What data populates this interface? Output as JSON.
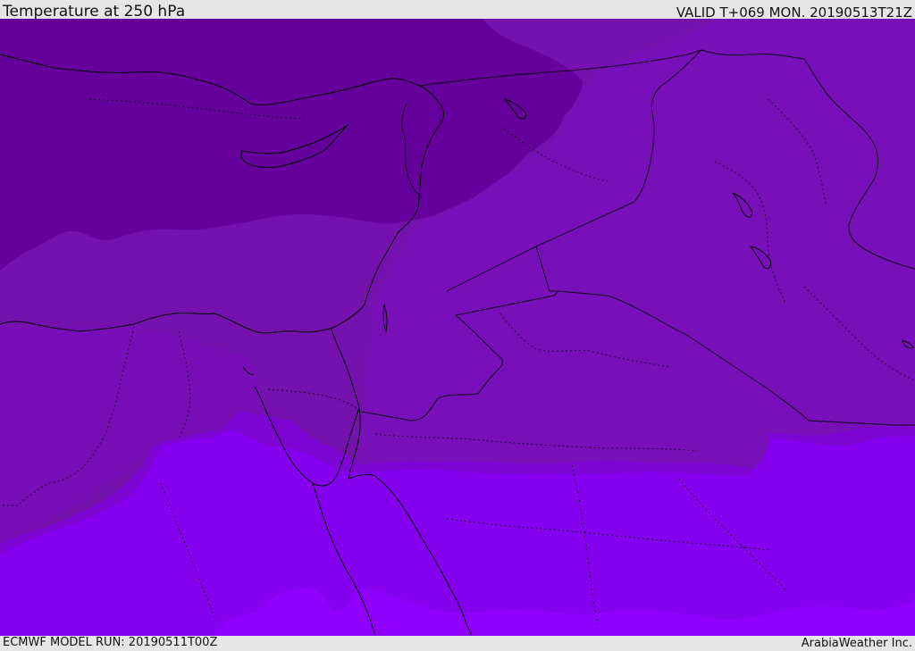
{
  "header": {
    "title": "Temperature at 250 hPa",
    "valid": "VALID T+069 MON. 20190513T21Z"
  },
  "footer": {
    "model_run": "ECMWF MODEL RUN: 20190511T00Z",
    "credit": "ArabiaWeather Inc."
  },
  "map": {
    "region": "Eastern Mediterranean / Middle East",
    "colors": {
      "band_coldest": "#65009a",
      "band_cold": "#7511ad",
      "band_mid": "#7d05d3",
      "band_warm": "#8400ee",
      "band_warmest": "#8f00fd",
      "coastline": "#000000",
      "border": "#1a0033"
    }
  }
}
